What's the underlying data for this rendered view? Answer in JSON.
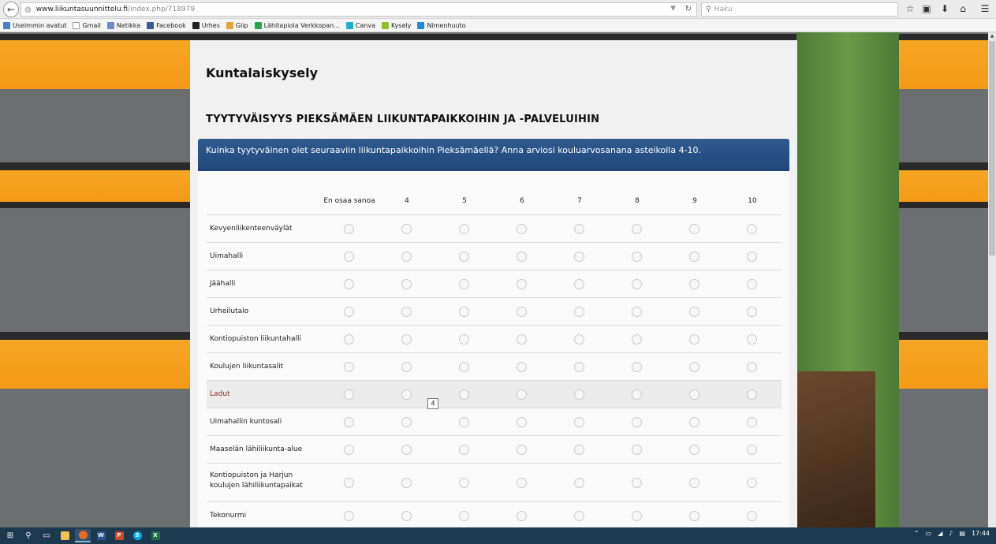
{
  "browser": {
    "url_domain": "www.liikuntasuunnittelu.fi",
    "url_path": "/index.php/718979",
    "search_placeholder": "Haku",
    "bookmarks": [
      {
        "label": "Useimmin avatut",
        "color": "#4a7fc1"
      },
      {
        "label": "Gmail",
        "color": "#ffffff"
      },
      {
        "label": "Netikka",
        "color": "#6b8cc7"
      },
      {
        "label": "Facebook",
        "color": "#3b5998"
      },
      {
        "label": "Urhes",
        "color": "#222222"
      },
      {
        "label": "Glip",
        "color": "#e8a33a"
      },
      {
        "label": "Lähitapiola Verkkopan...",
        "color": "#2aa34a"
      },
      {
        "label": "Canva",
        "color": "#19b3c9"
      },
      {
        "label": "Kysely",
        "color": "#8fbf2a"
      },
      {
        "label": "Nimenhuuto",
        "color": "#1f8ad6"
      }
    ]
  },
  "survey": {
    "title": "Kuntalaiskysely",
    "section_title": "TYYTYVÄISYYS PIEKSÄMÄEN LIIKUNTAPAIKKOIHIN JA -PALVELUIHIN",
    "question": "Kuinka tyytyväinen olet seuraaviin liikuntapaikkoihin Pieksämäellä? Anna arviosi kouluarvosanana asteikolla 4-10.",
    "columns": [
      "En osaa sanoa",
      "4",
      "5",
      "6",
      "7",
      "8",
      "9",
      "10"
    ],
    "rows": [
      {
        "label": "Kevyenliikenteenväylät",
        "highlight": false
      },
      {
        "label": "Uimahalli",
        "highlight": false
      },
      {
        "label": "Jäähalli",
        "highlight": false
      },
      {
        "label": "Urheilutalo",
        "highlight": false
      },
      {
        "label": "Kontiopuiston liikuntahalli",
        "highlight": false
      },
      {
        "label": "Koulujen liikuntasalit",
        "highlight": false
      },
      {
        "label": "Ladut",
        "highlight": true
      },
      {
        "label": "Uimahallin kuntosali",
        "highlight": false
      },
      {
        "label": "Maaselän lähiliikunta-alue",
        "highlight": false
      },
      {
        "label": "Kontiopuiston ja Harjun koulujen lähiliikuntapaikat",
        "highlight": false
      },
      {
        "label": "Tekonurmi",
        "highlight": false
      }
    ],
    "tooltip": "4"
  },
  "taskbar": {
    "apps": [
      {
        "name": "explorer",
        "glyph": "",
        "color": "#f2c14e"
      },
      {
        "name": "firefox",
        "glyph": "",
        "color": "#e66a1f"
      },
      {
        "name": "word",
        "glyph": "W",
        "color": "#2b5797"
      },
      {
        "name": "powerpoint",
        "glyph": "P",
        "color": "#d24726"
      },
      {
        "name": "skype",
        "glyph": "S",
        "color": "#00aff0"
      },
      {
        "name": "excel",
        "glyph": "X",
        "color": "#1e7145"
      }
    ],
    "clock": "17:44"
  }
}
